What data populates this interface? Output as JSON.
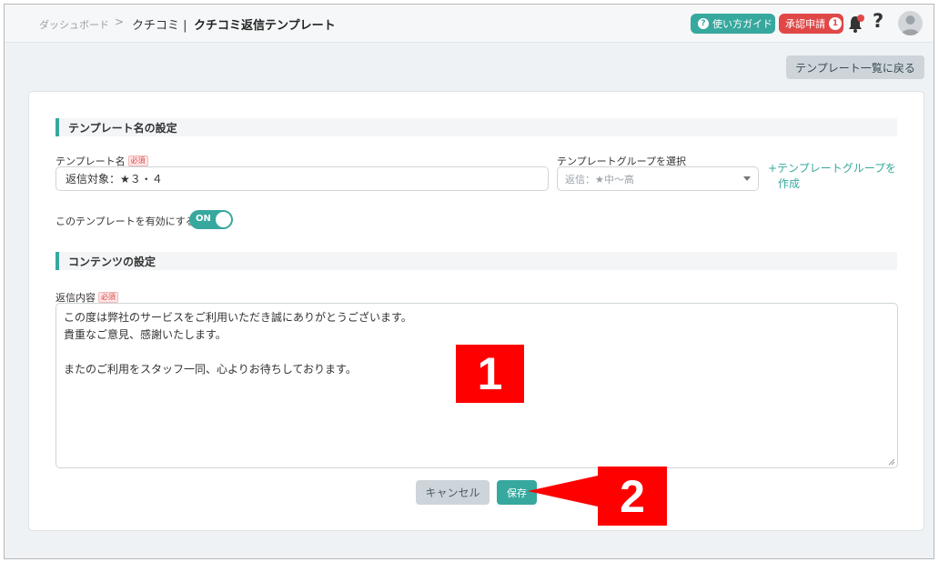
{
  "breadcrumb": {
    "items": [
      "ダッシュボード",
      "クチコミ",
      "クチコミ返信テンプレート"
    ],
    "separator": ">",
    "divider": "|"
  },
  "header": {
    "guide_label": "使い方ガイド",
    "guide_icon": "?",
    "approval_label": "承認申請",
    "approval_count": "1",
    "help_label": "?",
    "accent_color": "#37a89e",
    "alert_color": "#e04848"
  },
  "toolbar": {
    "back_label": "テンプレート一覧に戻る"
  },
  "sections": {
    "template_settings": "テンプレート名の設定",
    "content_settings": "コンテンツの設定"
  },
  "form": {
    "name_label": "テンプレート名",
    "required_badge": "必須",
    "name_value": "返信対象：★３・４",
    "group_label": "テンプレートグループを選択",
    "group_value": "返信：★中～高",
    "create_group_line1": "+テンプレートグループを",
    "create_group_line2": "作成",
    "enable_label": "このテンプレートを有効にする",
    "toggle_on": "ON",
    "content_label": "返信内容",
    "content_lines": [
      "この度は弊社のサービスをご利用いただき誠にありがとうございます。",
      "貴重なご意見、感謝いたします。",
      "",
      "またのご利用をスタッフ一同、心よりお待ちしております。"
    ],
    "cancel_label": "キャンセル",
    "save_label": "保存"
  },
  "annotations": {
    "marker1": "1",
    "marker2": "2",
    "marker_color": "#ff0000"
  }
}
